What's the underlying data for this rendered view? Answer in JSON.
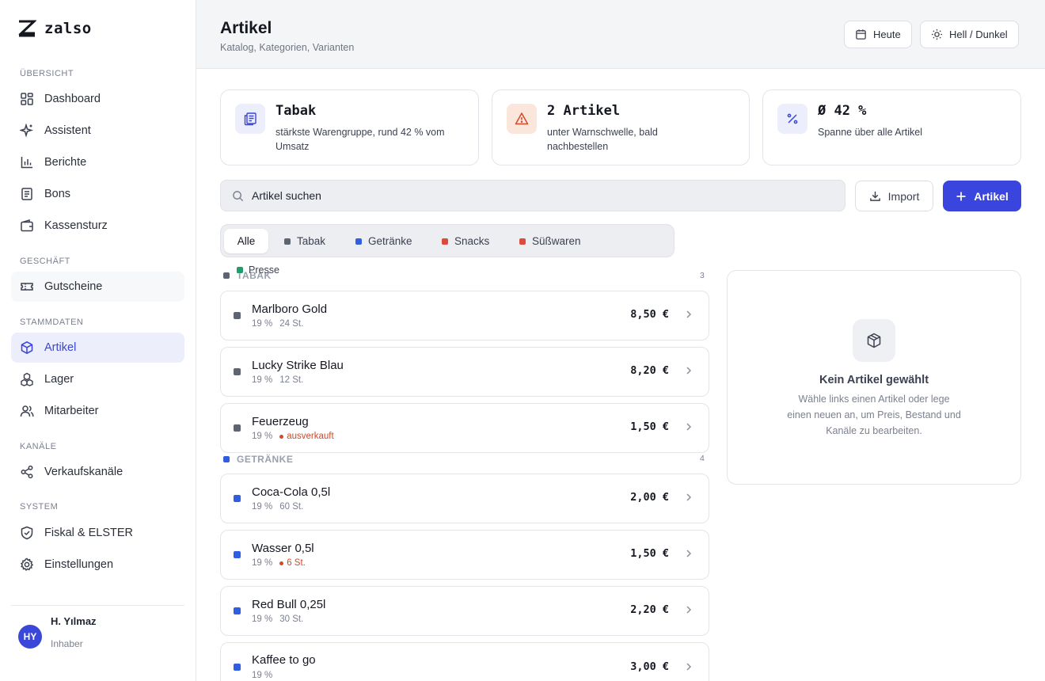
{
  "app": {
    "name": "zalso"
  },
  "sidebar": {
    "sections": [
      {
        "label": "ÜBERSICHT",
        "items": [
          {
            "label": "Dashboard",
            "icon": "dashboard-icon"
          },
          {
            "label": "Assistent",
            "icon": "sparkle-icon"
          },
          {
            "label": "Berichte",
            "icon": "chart-icon"
          },
          {
            "label": "Bons",
            "icon": "receipt-icon"
          },
          {
            "label": "Kassensturz",
            "icon": "wallet-icon"
          }
        ]
      },
      {
        "label": "GESCHÄFT",
        "items": [
          {
            "label": "Gutscheine",
            "icon": "ticket-icon"
          }
        ]
      },
      {
        "label": "STAMMDATEN",
        "items": [
          {
            "label": "Artikel",
            "icon": "box-icon",
            "active": true
          },
          {
            "label": "Lager",
            "icon": "boxes-icon"
          },
          {
            "label": "Mitarbeiter",
            "icon": "users-icon"
          }
        ]
      },
      {
        "label": "KANÄLE",
        "items": [
          {
            "label": "Verkaufskanäle",
            "icon": "share-icon"
          }
        ]
      },
      {
        "label": "SYSTEM",
        "items": [
          {
            "label": "Fiskal & ELSTER",
            "icon": "shield-icon"
          },
          {
            "label": "Einstellungen",
            "icon": "gear-icon"
          }
        ]
      }
    ],
    "user": {
      "initials": "HY",
      "name": "H. Yılmaz",
      "role": "Inhaber"
    }
  },
  "header": {
    "title": "Artikel",
    "subtitle": "Katalog, Kategorien, Varianten",
    "today_label": "Heute",
    "theme_label": "Hell / Dunkel"
  },
  "kpis": [
    {
      "title": "Tabak",
      "desc": "stärkste Warengruppe, rund 42 % vom Umsatz",
      "icon": "document-icon"
    },
    {
      "title": "2 Artikel",
      "desc": "unter Warnschwelle, bald nachbestellen",
      "icon": "warning-icon"
    },
    {
      "title": "Ø 42 %",
      "desc": "Spanne über alle Artikel",
      "icon": "percent-icon"
    }
  ],
  "search": {
    "placeholder": "Artikel suchen"
  },
  "actions": {
    "import_label": "Import",
    "add_label": "Artikel"
  },
  "filters": {
    "all": "Alle",
    "categories": [
      {
        "label": "Tabak",
        "color": "#5f6472"
      },
      {
        "label": "Getränke",
        "color": "#2f5fe0"
      },
      {
        "label": "Snacks",
        "color": "#dd4b3a"
      },
      {
        "label": "Süßwaren",
        "color": "#dd4b3a"
      },
      {
        "label": "Presse",
        "color": "#1f9d6b"
      }
    ]
  },
  "groups": [
    {
      "label": "TABAK",
      "count": "3",
      "color": "#5f6472",
      "items": [
        {
          "name": "Marlboro Gold",
          "vat": "19 %",
          "stock": "24 St.",
          "price": "8,50 €"
        },
        {
          "name": "Lucky Strike Blau",
          "vat": "19 %",
          "stock": "12 St.",
          "price": "8,20 €"
        },
        {
          "name": "Feuerzeug",
          "vat": "19 %",
          "warning": "ausverkauft",
          "price": "1,50 €"
        }
      ]
    },
    {
      "label": "GETRÄNKE",
      "count": "4",
      "color": "#2f5fe0",
      "items": [
        {
          "name": "Coca-Cola 0,5l",
          "vat": "19 %",
          "stock": "60 St.",
          "price": "2,00 €"
        },
        {
          "name": "Wasser 0,5l",
          "vat": "19 %",
          "warning": "6 St.",
          "price": "1,50 €"
        },
        {
          "name": "Red Bull 0,25l",
          "vat": "19 %",
          "stock": "30 St.",
          "price": "2,20 €"
        },
        {
          "name": "Kaffee to go",
          "vat": "19 %",
          "stock": "",
          "price": "3,00 €"
        }
      ]
    }
  ],
  "detail": {
    "title": "Kein Artikel gewählt",
    "text": "Wähle links einen Artikel oder lege einen neuen an, um Preis, Bestand und Kanäle zu bearbeiten."
  }
}
